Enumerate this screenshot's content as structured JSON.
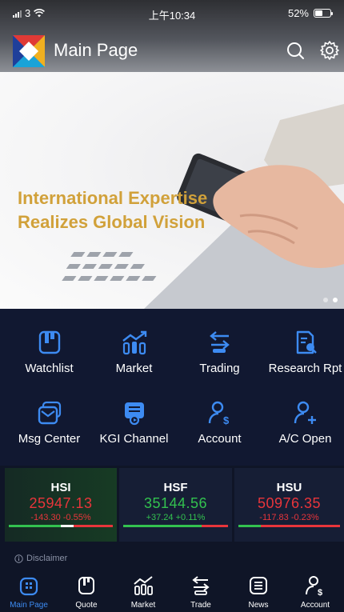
{
  "status_bar": {
    "carrier": "3",
    "time": "上午10:34",
    "battery": "52%",
    "battery_level": 0.52
  },
  "header": {
    "title": "Main Page",
    "icons": [
      "search-icon",
      "gear-icon"
    ]
  },
  "banner": {
    "headline_line1": "International Expertise",
    "headline_line2": "Realizes Global Vision",
    "slides": 2,
    "active_slide": 2
  },
  "quick_menu": [
    {
      "label": "Watchlist",
      "icon": "watchlist-icon"
    },
    {
      "label": "Market",
      "icon": "market-icon"
    },
    {
      "label": "Trading",
      "icon": "trading-icon"
    },
    {
      "label": "Research Rpt",
      "icon": "research-report-icon"
    },
    {
      "label": "Msg Center",
      "icon": "message-center-icon"
    },
    {
      "label": "KGI Channel",
      "icon": "channel-icon"
    },
    {
      "label": "Account",
      "icon": "account-icon"
    },
    {
      "label": "A/C Open",
      "icon": "account-open-icon"
    }
  ],
  "indices": [
    {
      "name": "HSI",
      "value": "25947.13",
      "change": "-143.30 -0.55%",
      "direction": "down",
      "color": "#e8353b",
      "highlight": true
    },
    {
      "name": "HSF",
      "value": "35144.56",
      "change": "+37.24 +0.11%",
      "direction": "up",
      "color": "#33c24f",
      "highlight": false
    },
    {
      "name": "HSU",
      "value": "50976.35",
      "change": "-117.83 -0.23%",
      "direction": "down",
      "color": "#e8353b",
      "highlight": false
    }
  ],
  "disclaimer": "Disclaimer",
  "bottom_nav": [
    {
      "label": "Main Page",
      "icon": "home-icon",
      "active": true
    },
    {
      "label": "Quote",
      "icon": "quote-icon",
      "active": false
    },
    {
      "label": "Market",
      "icon": "market-icon",
      "active": false
    },
    {
      "label": "Trade",
      "icon": "trade-icon",
      "active": false
    },
    {
      "label": "News",
      "icon": "news-icon",
      "active": false
    },
    {
      "label": "Account",
      "icon": "account-icon",
      "active": false
    }
  ],
  "colors": {
    "accent": "#3d8bf2",
    "background": "#0f1527",
    "banner_text": "#d1a13a",
    "down": "#e8353b",
    "up": "#33c24f"
  }
}
